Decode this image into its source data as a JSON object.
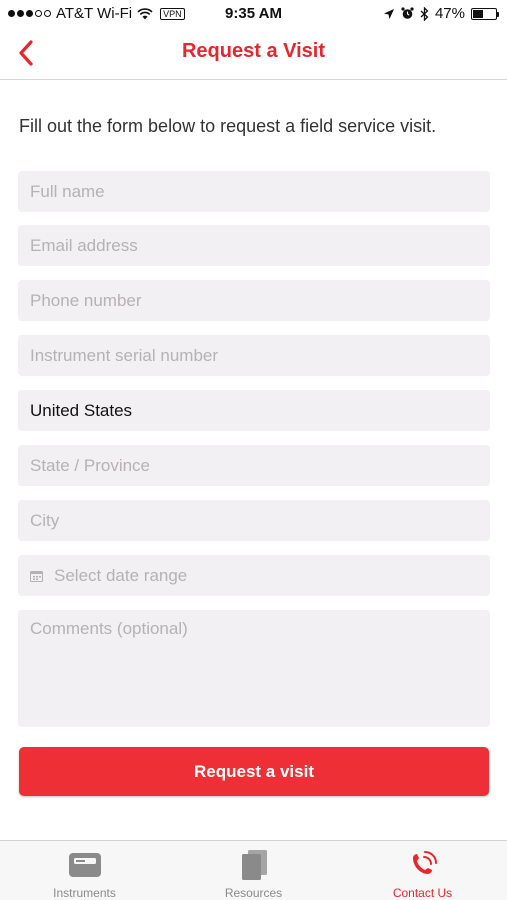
{
  "status_bar": {
    "carrier": "AT&T Wi-Fi",
    "vpn": "VPN",
    "time": "9:35 AM",
    "battery_percent": "47%",
    "battery_level": 0.47,
    "icons": [
      "signal-dots",
      "wifi-icon",
      "location-arrow-icon",
      "alarm-icon",
      "bluetooth-icon",
      "battery-icon"
    ]
  },
  "nav": {
    "title": "Request a Visit",
    "back_icon": "chevron-left-icon"
  },
  "form": {
    "intro": "Fill out the form below to request a field service visit.",
    "full_name_placeholder": "Full name",
    "email_placeholder": "Email address",
    "phone_placeholder": "Phone number",
    "serial_placeholder": "Instrument serial number",
    "country_value": "United States",
    "state_placeholder": "State / Province",
    "city_placeholder": "City",
    "date_placeholder": "Select date range",
    "comments_placeholder": "Comments (optional)",
    "submit_label": "Request a visit"
  },
  "tabs": [
    {
      "label": "Instruments",
      "icon": "instrument-icon",
      "active": false
    },
    {
      "label": "Resources",
      "icon": "documents-icon",
      "active": false
    },
    {
      "label": "Contact Us",
      "icon": "phone-icon",
      "active": true
    }
  ],
  "colors": {
    "accent": "#e8262c",
    "button": "#ee2f35",
    "field_bg": "#f2f0f2",
    "placeholder": "#b5b2b5",
    "tab_inactive": "#8a8a8a"
  }
}
